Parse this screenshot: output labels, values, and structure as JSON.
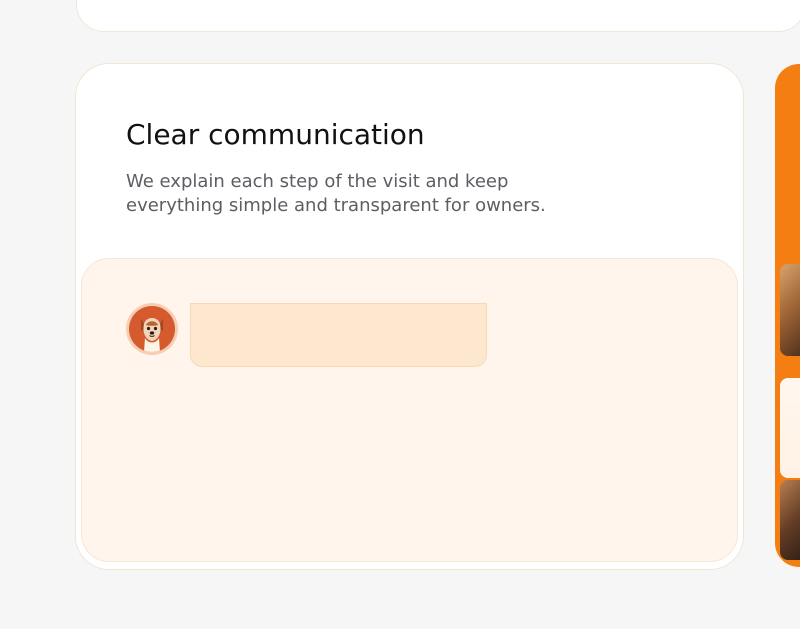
{
  "feature": {
    "title": "Clear communication",
    "description": "We explain each step of the visit and keep everything simple and transparent for owners."
  },
  "chat_preview": {
    "avatar_icon": "dog-avatar-icon",
    "message_text": ""
  },
  "colors": {
    "accent": "#f47e12",
    "panel_background": "#fff5ec",
    "message_bubble": "#fde8cf"
  }
}
